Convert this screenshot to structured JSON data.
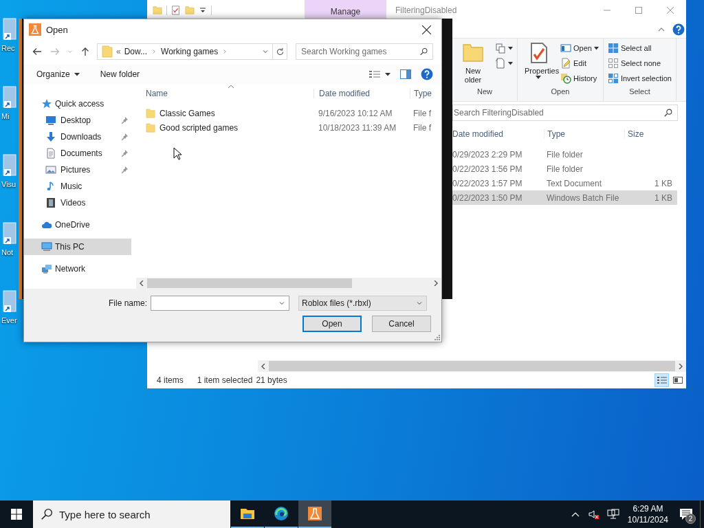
{
  "desktop_icons": [
    {
      "label": "Rec"
    },
    {
      "label": "Mi"
    },
    {
      "label": "Visu"
    },
    {
      "label": "Not"
    },
    {
      "label": "Ever"
    }
  ],
  "explorer": {
    "context_tab": "Manage",
    "title": "FilteringDisabled",
    "ribbon": {
      "groups": [
        {
          "label": "New",
          "items": [
            {
              "kind": "large",
              "label": "New older"
            },
            {
              "kind": "icon",
              "dropdown": true
            },
            {
              "kind": "icon",
              "dropdown": true
            }
          ]
        },
        {
          "label": "Open",
          "items": [
            {
              "kind": "large",
              "label": "Properties",
              "dropdown": true
            },
            {
              "kind": "small",
              "label": "Open",
              "dropdown": true
            },
            {
              "kind": "small",
              "label": "Edit",
              "dropdown": false
            },
            {
              "kind": "small",
              "label": "History",
              "dropdown": false
            }
          ]
        },
        {
          "label": "Select",
          "items": [
            {
              "kind": "small",
              "label": "Select all",
              "dropdown": false
            },
            {
              "kind": "small",
              "label": "Select none",
              "dropdown": false
            },
            {
              "kind": "small",
              "label": "Invert selection",
              "dropdown": false
            }
          ]
        }
      ]
    },
    "search": {
      "placeholder": "Search FilteringDisabled"
    },
    "columns": [
      "Date modified",
      "Type",
      "Size"
    ],
    "rows": [
      {
        "date": "0/29/2023 2:29 PM",
        "type": "File folder",
        "selected": false
      },
      {
        "date": "0/22/2023 1:56 PM",
        "type": "File folder",
        "selected": false
      },
      {
        "date": "0/22/2023 1:57 PM",
        "type": "Text Document",
        "size": "1 KB",
        "selected": false
      },
      {
        "date": "0/22/2023 1:50 PM",
        "type": "Windows Batch File",
        "size": "1 KB",
        "selected": true
      }
    ],
    "status_bar": {
      "item_count": "4 items",
      "selection": "1 item selected",
      "size": "21 bytes"
    },
    "views": [
      {
        "selected": true
      },
      {
        "selected": false
      }
    ]
  },
  "dialog": {
    "title": "Open",
    "address": {
      "overflow": "«",
      "crumbs": [
        "Dow...",
        "Working games"
      ]
    },
    "search": {
      "placeholder": "Search Working games"
    },
    "toolbar": {
      "organize": "Organize",
      "new_folder": "New folder"
    },
    "nav": [
      {
        "label": "Quick access",
        "selected": false,
        "children": [
          {
            "label": "Desktop",
            "pinned": true,
            "selected": false
          },
          {
            "label": "Downloads",
            "pinned": true,
            "selected": false
          },
          {
            "label": "Documents",
            "pinned": true,
            "selected": false
          },
          {
            "label": "Pictures",
            "pinned": true,
            "selected": false
          },
          {
            "label": "Music",
            "pinned": false,
            "selected": false
          },
          {
            "label": "Videos",
            "pinned": false,
            "selected": false
          }
        ]
      },
      {
        "label": "OneDrive",
        "selected": false
      },
      {
        "label": "This PC",
        "selected": true
      },
      {
        "label": "Network",
        "selected": false
      }
    ],
    "columns": [
      "Name",
      "Date modified",
      "Type"
    ],
    "files": [
      {
        "name": "Classic Games",
        "date": "9/16/2023 10:12 AM",
        "type": "File f",
        "selected": false
      },
      {
        "name": "Good scripted games",
        "date": "10/18/2023 11:39 AM",
        "type": "File f",
        "selected": false
      }
    ],
    "file_name": {
      "label": "File name:"
    },
    "file_type": "Roblox files (*.rbxl)",
    "buttons": [
      {
        "label": "Open",
        "default": true
      },
      {
        "label": "Cancel",
        "default": false
      }
    ]
  },
  "taskbar": {
    "search": {
      "placeholder": "Type here to search"
    },
    "apps": [
      {
        "active": false
      },
      {
        "active": false
      },
      {
        "active": true
      }
    ],
    "clock": {
      "time": "6:29 AM",
      "date": "10/11/2024"
    },
    "notifications": "2"
  }
}
